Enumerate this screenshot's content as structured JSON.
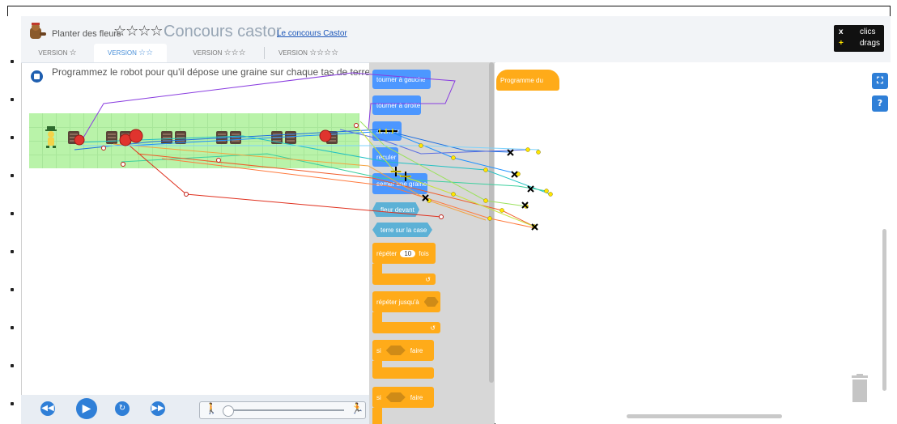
{
  "header": {
    "title_prefix": "Planter des fleurs",
    "title_stars": "☆☆☆☆",
    "title_main": "Concours castor",
    "contest_link": "Le concours Castor",
    "tabs": [
      {
        "label": "VERSION",
        "stars": "☆"
      },
      {
        "label": "VERSION",
        "stars": "☆☆",
        "active": true
      },
      {
        "label": "VERSION",
        "stars": "☆☆☆"
      },
      {
        "label": "VERSION",
        "stars": "☆☆☆☆"
      }
    ]
  },
  "statement": "Programmez le robot pour qu'il dépose une graine sur chaque tas de terre.",
  "palette": {
    "blocks": [
      {
        "label": "tourner à gauche",
        "color": "#4c97ff"
      },
      {
        "label": "tourner à droite",
        "color": "#4c97ff"
      },
      {
        "label": "avancer",
        "color": "#4c97ff"
      },
      {
        "label": "reculer",
        "color": "#4c97ff"
      },
      {
        "label": "semer une graine",
        "color": "#4c97ff"
      },
      {
        "label": "fleur devant",
        "color": "#5cb1d6"
      },
      {
        "label": "terre sur la case",
        "color": "#5cb1d6"
      },
      {
        "label_before": "répéter",
        "number": "10",
        "label_after": "fois",
        "color": "#ffab19"
      },
      {
        "label": "répéter jusqu'à",
        "color": "#ffab19"
      },
      {
        "label_before": "si",
        "label_after": "faire",
        "color": "#ffab19"
      },
      {
        "label_before": "si",
        "label_after": "faire",
        "color": "#ffab19"
      }
    ]
  },
  "workspace": {
    "hat_block": "Programme du robot",
    "fullscreen_icon": "fullscreen-icon",
    "help_label": "?"
  },
  "legend": {
    "clicks_label": "clics",
    "drags_label": "drags",
    "clicks_mark": "x",
    "drags_mark": "+"
  },
  "controls": {
    "icons": [
      "rewind-icon",
      "play-icon",
      "step-icon",
      "fast-forward-icon"
    ],
    "speed_slow_icon": "walking-icon",
    "speed_fast_icon": "running-icon"
  },
  "colors": {
    "motion": "#4c97ff",
    "control": "#ffab19",
    "sensing": "#5cb1d6",
    "grid": "#b9f3a9",
    "accent": "#2f7fd7"
  }
}
